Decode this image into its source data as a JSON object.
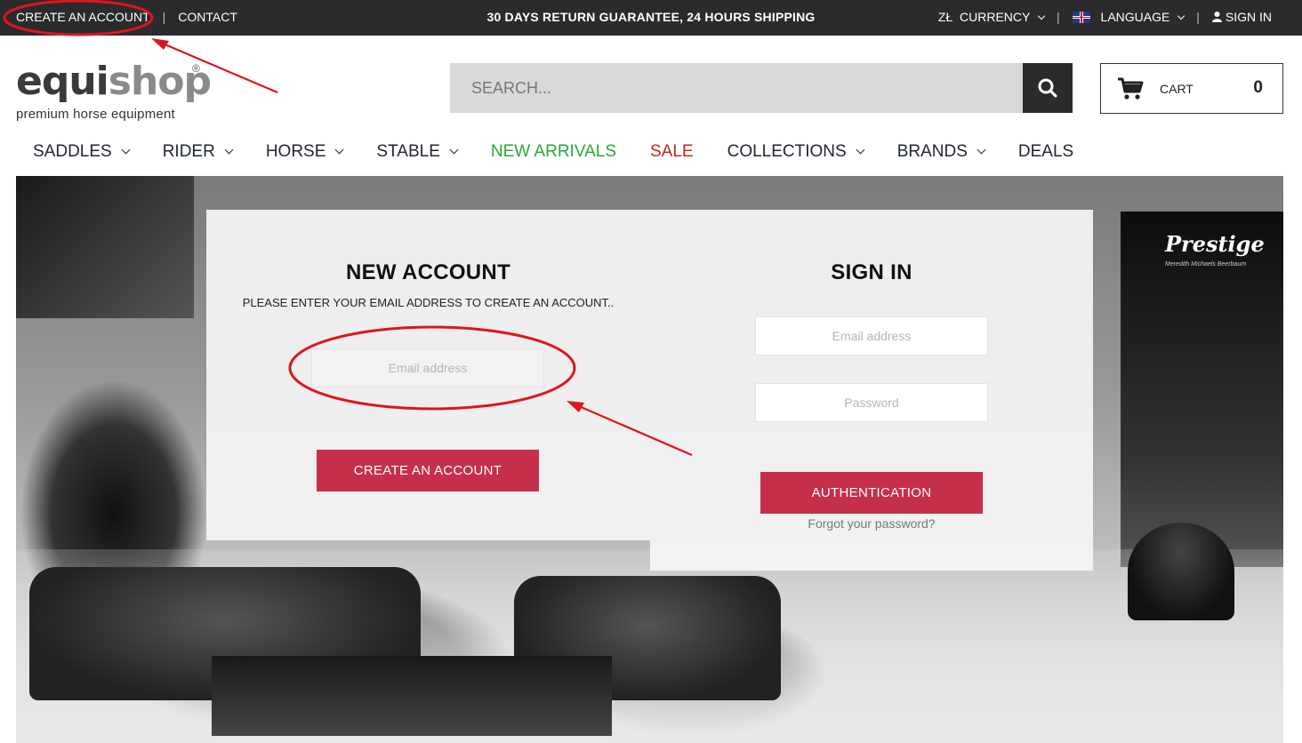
{
  "topbar": {
    "create_account": "CREATE AN ACCOUNT",
    "contact": "CONTACT",
    "promo": "30 DAYS RETURN GUARANTEE, 24 HOURS SHIPPING",
    "currency_symbol": "ZŁ",
    "currency": "CURRENCY",
    "language": "LANGUAGE",
    "sign_in": "SIGN IN",
    "separator": "|"
  },
  "logo": {
    "part1": "equi",
    "part2": "shop",
    "registered": "®",
    "tagline": "premium horse equipment"
  },
  "search": {
    "placeholder": "SEARCH..."
  },
  "cart": {
    "label": "CART",
    "count": "0"
  },
  "nav": {
    "items": [
      {
        "label": "SADDLES",
        "dropdown": true
      },
      {
        "label": "RIDER",
        "dropdown": true
      },
      {
        "label": "HORSE",
        "dropdown": true
      },
      {
        "label": "STABLE",
        "dropdown": true
      },
      {
        "label": "NEW ARRIVALS",
        "dropdown": false,
        "color": "#2aa63a"
      },
      {
        "label": "SALE",
        "dropdown": false,
        "color": "#c0281f"
      },
      {
        "label": "COLLECTIONS",
        "dropdown": true
      },
      {
        "label": "BRANDS",
        "dropdown": true
      },
      {
        "label": "DEALS",
        "dropdown": false
      }
    ]
  },
  "hero": {
    "poster_title": "Prestige",
    "poster_sub": "Meredith Michaels Beerbaum"
  },
  "new_account": {
    "title": "NEW ACCOUNT",
    "subtitle": "PLEASE ENTER YOUR EMAIL ADDRESS TO CREATE AN ACCOUNT..",
    "email_placeholder": "Email address",
    "button": "CREATE AN ACCOUNT"
  },
  "sign_in": {
    "title": "SIGN IN",
    "email_placeholder": "Email address",
    "password_placeholder": "Password",
    "button": "AUTHENTICATION",
    "forgot": "Forgot your password?"
  },
  "colors": {
    "topbar_bg": "#2b2b2d",
    "accent_red": "#c62f4a",
    "new_arrivals": "#2aa63a",
    "sale": "#c0281f",
    "annotation": "#e0141e"
  }
}
